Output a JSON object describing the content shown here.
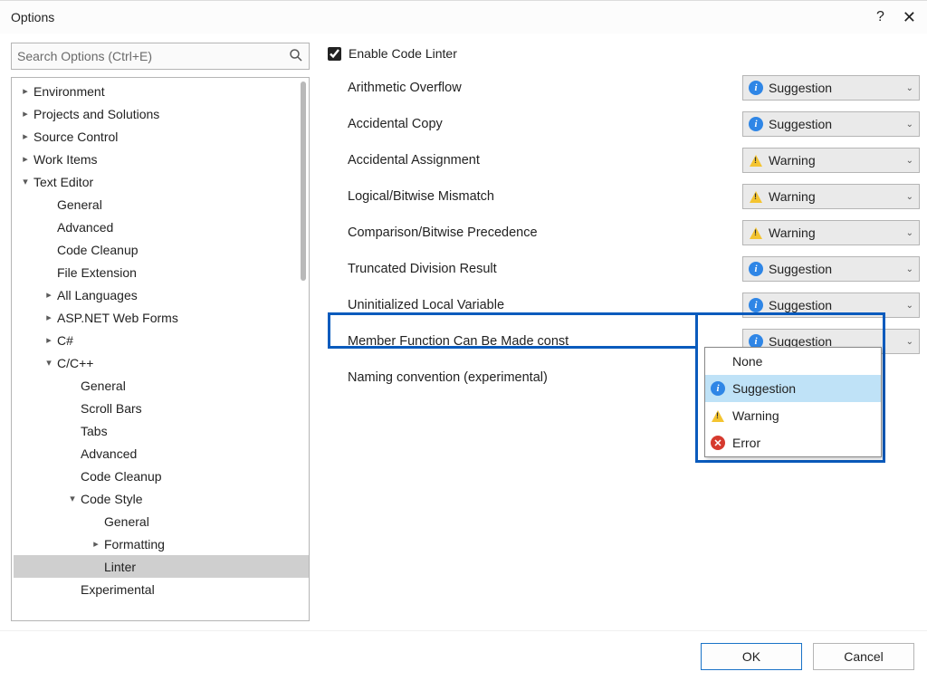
{
  "window": {
    "title": "Options",
    "help_alt": "Help",
    "close_alt": "Close"
  },
  "search": {
    "placeholder": "Search Options (Ctrl+E)"
  },
  "tree": [
    {
      "label": "Environment",
      "depth": 0,
      "tw": "closed"
    },
    {
      "label": "Projects and Solutions",
      "depth": 0,
      "tw": "closed"
    },
    {
      "label": "Source Control",
      "depth": 0,
      "tw": "closed"
    },
    {
      "label": "Work Items",
      "depth": 0,
      "tw": "closed"
    },
    {
      "label": "Text Editor",
      "depth": 0,
      "tw": "open"
    },
    {
      "label": "General",
      "depth": 1,
      "tw": "none"
    },
    {
      "label": "Advanced",
      "depth": 1,
      "tw": "none"
    },
    {
      "label": "Code Cleanup",
      "depth": 1,
      "tw": "none"
    },
    {
      "label": "File Extension",
      "depth": 1,
      "tw": "none"
    },
    {
      "label": "All Languages",
      "depth": 1,
      "tw": "closed"
    },
    {
      "label": "ASP.NET Web Forms",
      "depth": 1,
      "tw": "closed"
    },
    {
      "label": "C#",
      "depth": 1,
      "tw": "closed"
    },
    {
      "label": "C/C++",
      "depth": 1,
      "tw": "open"
    },
    {
      "label": "General",
      "depth": 2,
      "tw": "none"
    },
    {
      "label": "Scroll Bars",
      "depth": 2,
      "tw": "none"
    },
    {
      "label": "Tabs",
      "depth": 2,
      "tw": "none"
    },
    {
      "label": "Advanced",
      "depth": 2,
      "tw": "none"
    },
    {
      "label": "Code Cleanup",
      "depth": 2,
      "tw": "none"
    },
    {
      "label": "Code Style",
      "depth": 2,
      "tw": "open"
    },
    {
      "label": "General",
      "depth": 3,
      "tw": "none"
    },
    {
      "label": "Formatting",
      "depth": 3,
      "tw": "closed"
    },
    {
      "label": "Linter",
      "depth": 3,
      "tw": "none",
      "selected": true
    },
    {
      "label": "Experimental",
      "depth": 2,
      "tw": "none"
    }
  ],
  "checkbox": {
    "label": "Enable Code Linter",
    "checked": true
  },
  "settings": [
    {
      "label": "Arithmetic Overflow",
      "value": "Suggestion",
      "icon": "info"
    },
    {
      "label": "Accidental Copy",
      "value": "Suggestion",
      "icon": "info"
    },
    {
      "label": "Accidental Assignment",
      "value": "Warning",
      "icon": "warn"
    },
    {
      "label": "Logical/Bitwise Mismatch",
      "value": "Warning",
      "icon": "warn"
    },
    {
      "label": "Comparison/Bitwise Precedence",
      "value": "Warning",
      "icon": "warn"
    },
    {
      "label": "Truncated Division Result",
      "value": "Suggestion",
      "icon": "info"
    },
    {
      "label": "Uninitialized Local Variable",
      "value": "Suggestion",
      "icon": "info"
    },
    {
      "label": "Member Function Can Be Made const",
      "value": "Suggestion",
      "icon": "info",
      "open": true
    },
    {
      "label": "Naming convention (experimental)",
      "value": "",
      "icon": "",
      "hidden_combo": true
    }
  ],
  "dropdown_options": [
    {
      "label": "None",
      "icon": ""
    },
    {
      "label": "Suggestion",
      "icon": "info",
      "selected": true
    },
    {
      "label": "Warning",
      "icon": "warn"
    },
    {
      "label": "Error",
      "icon": "err"
    }
  ],
  "buttons": {
    "ok": "OK",
    "cancel": "Cancel"
  }
}
